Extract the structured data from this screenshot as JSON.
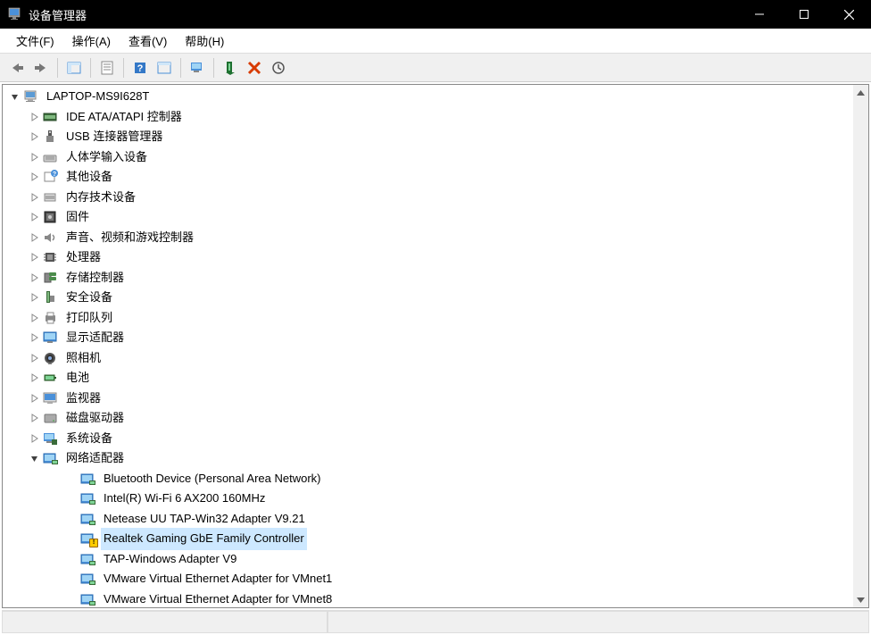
{
  "window": {
    "title": "设备管理器"
  },
  "menus": {
    "file": "文件(F)",
    "action": "操作(A)",
    "view": "查看(V)",
    "help": "帮助(H)"
  },
  "tree": {
    "root": "LAPTOP-MS9I628T",
    "categories": [
      {
        "label": "IDE ATA/ATAPI 控制器",
        "icon": "ide"
      },
      {
        "label": "USB 连接器管理器",
        "icon": "usb"
      },
      {
        "label": "人体学输入设备",
        "icon": "hid"
      },
      {
        "label": "其他设备",
        "icon": "other"
      },
      {
        "label": "内存技术设备",
        "icon": "memory"
      },
      {
        "label": "固件",
        "icon": "firmware"
      },
      {
        "label": "声音、视频和游戏控制器",
        "icon": "sound"
      },
      {
        "label": "处理器",
        "icon": "cpu"
      },
      {
        "label": "存储控制器",
        "icon": "storage"
      },
      {
        "label": "安全设备",
        "icon": "security"
      },
      {
        "label": "打印队列",
        "icon": "printer"
      },
      {
        "label": "显示适配器",
        "icon": "display"
      },
      {
        "label": "照相机",
        "icon": "camera"
      },
      {
        "label": "电池",
        "icon": "battery"
      },
      {
        "label": "监视器",
        "icon": "monitor"
      },
      {
        "label": "磁盘驱动器",
        "icon": "disk"
      },
      {
        "label": "系统设备",
        "icon": "system"
      },
      {
        "label": "网络适配器",
        "icon": "network",
        "expanded": true,
        "children": [
          {
            "label": "Bluetooth Device (Personal Area Network)"
          },
          {
            "label": "Intel(R) Wi-Fi 6 AX200 160MHz"
          },
          {
            "label": "Netease UU TAP-Win32 Adapter V9.21"
          },
          {
            "label": "Realtek Gaming GbE Family Controller",
            "selected": true,
            "warning": true
          },
          {
            "label": "TAP-Windows Adapter V9"
          },
          {
            "label": "VMware Virtual Ethernet Adapter for VMnet1"
          },
          {
            "label": "VMware Virtual Ethernet Adapter for VMnet8"
          }
        ]
      }
    ]
  }
}
